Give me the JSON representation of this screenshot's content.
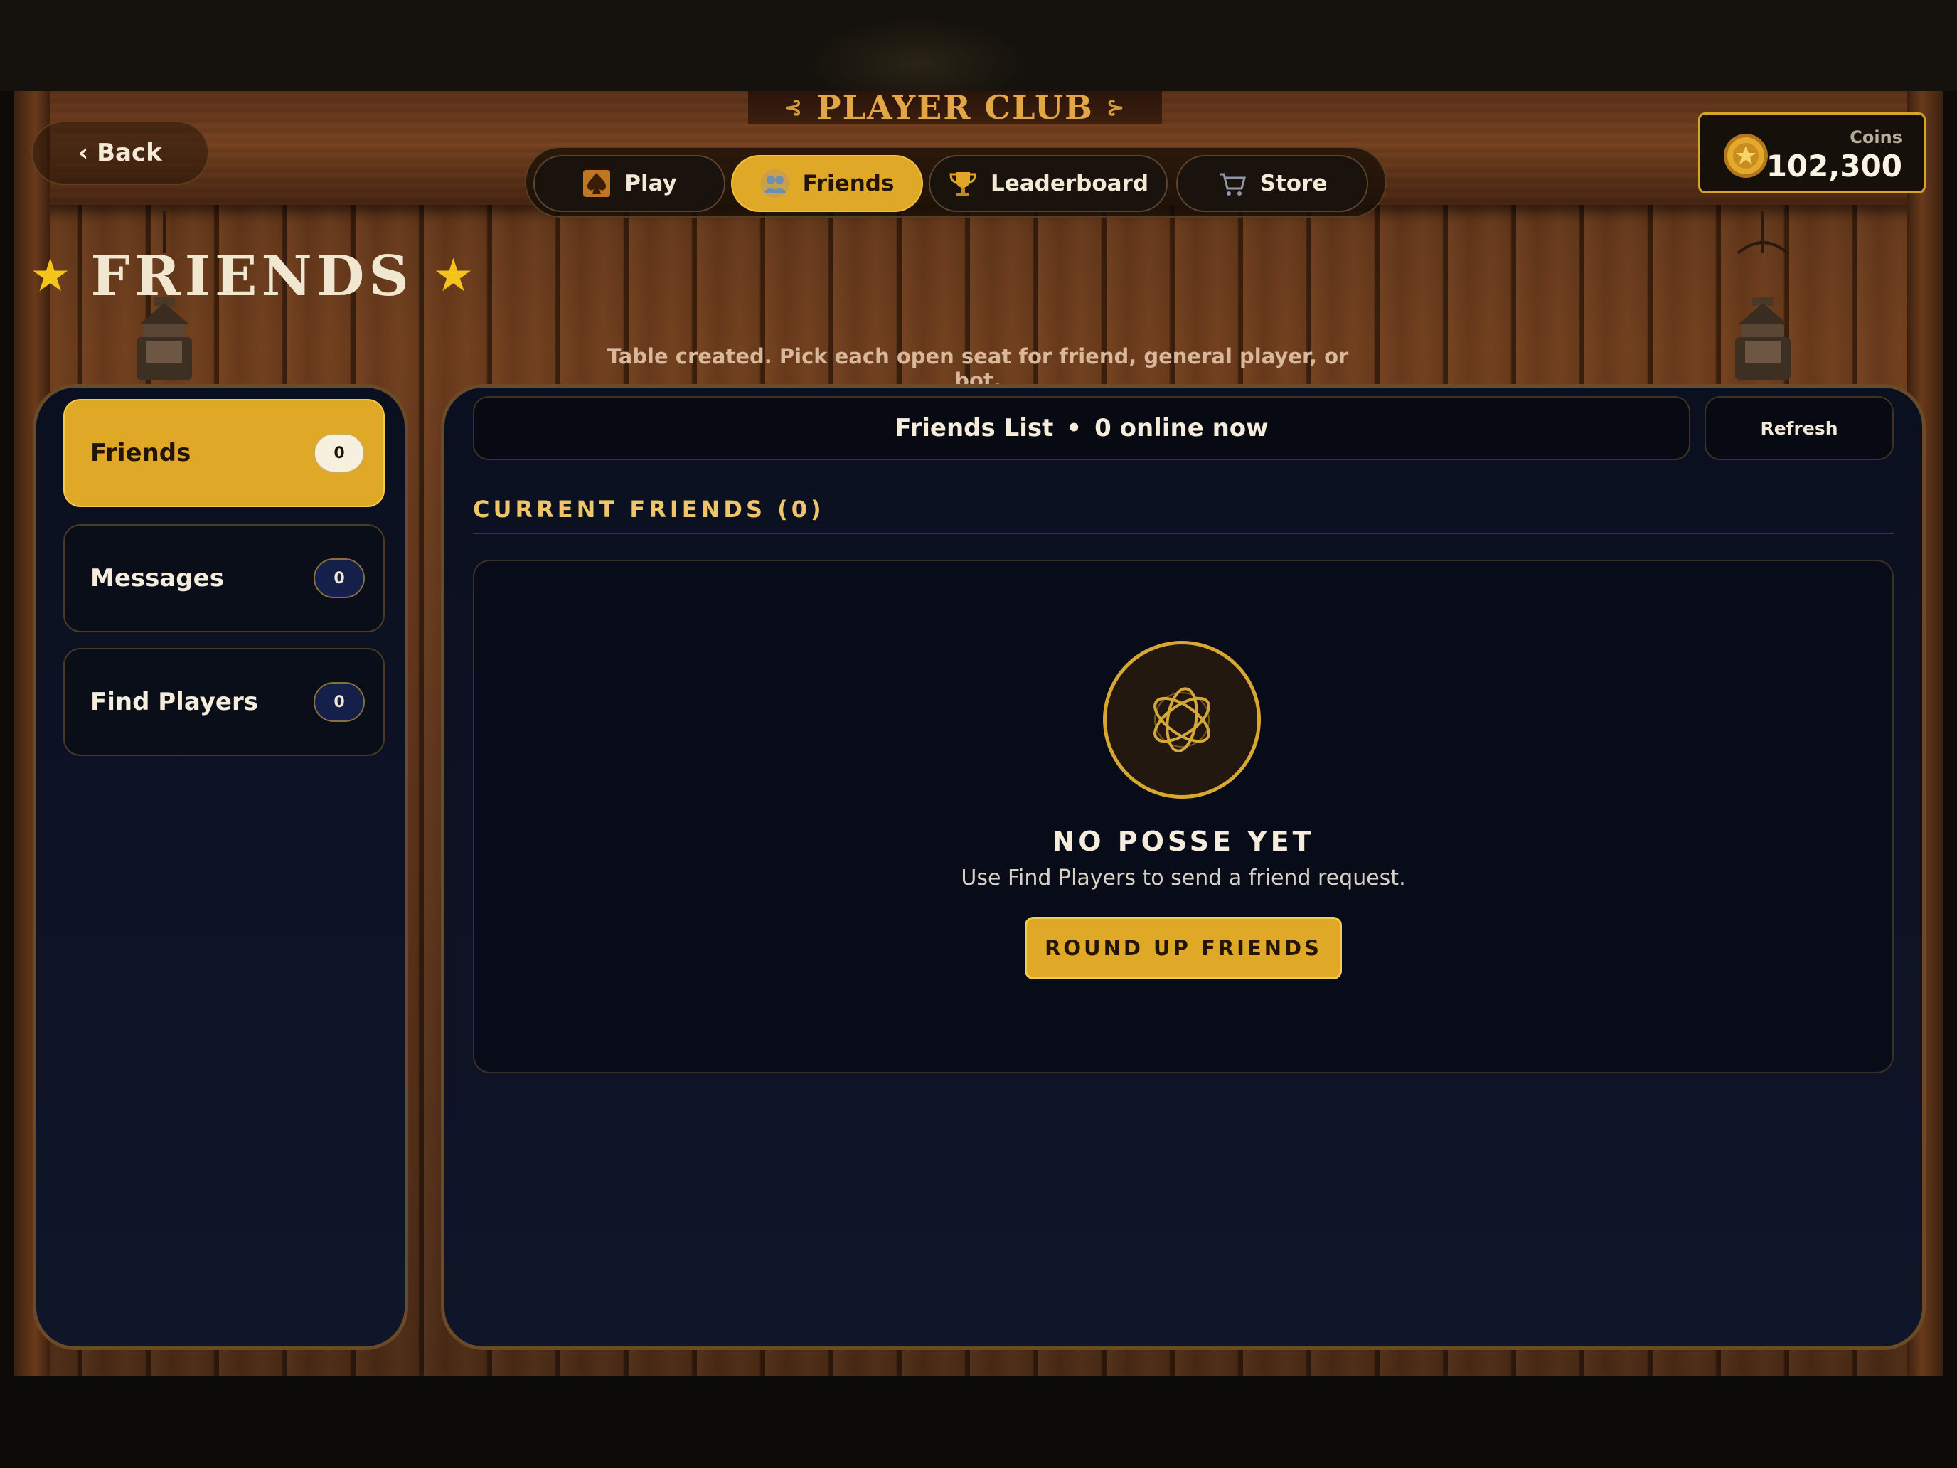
{
  "header": {
    "back_label": "‹ Back",
    "club_title": "PLAYER CLUB",
    "nav_tabs": [
      {
        "label": "Play",
        "icon": "spade-icon",
        "active": false
      },
      {
        "label": "Friends",
        "icon": "friends-icon",
        "active": true
      },
      {
        "label": "Leaderboard",
        "icon": "trophy-icon",
        "active": false
      },
      {
        "label": "Store",
        "icon": "cart-icon",
        "active": false
      }
    ],
    "coins": {
      "label": "Coins",
      "value": "102,300"
    }
  },
  "page": {
    "title": "FRIENDS",
    "notice": "Table created. Pick each open seat for friend, general player, or bot."
  },
  "sidebar": {
    "items": [
      {
        "label": "Friends",
        "count": "0",
        "active": true
      },
      {
        "label": "Messages",
        "count": "0",
        "active": false
      },
      {
        "label": "Find Players",
        "count": "0",
        "active": false
      }
    ]
  },
  "main": {
    "list_title": "Friends List",
    "separator": "•",
    "online_status": "0 online now",
    "refresh_label": "Refresh",
    "section_heading": "CURRENT FRIENDS (0)",
    "empty": {
      "title": "NO POSSE YET",
      "subtitle": "Use Find Players to send a friend request.",
      "cta": "ROUND UP FRIENDS"
    }
  },
  "colors": {
    "accent_gold": "#dfa826",
    "panel_navy": "#0f1629",
    "wood": "#6e3d1c",
    "frame_border": "#6b4a27"
  }
}
